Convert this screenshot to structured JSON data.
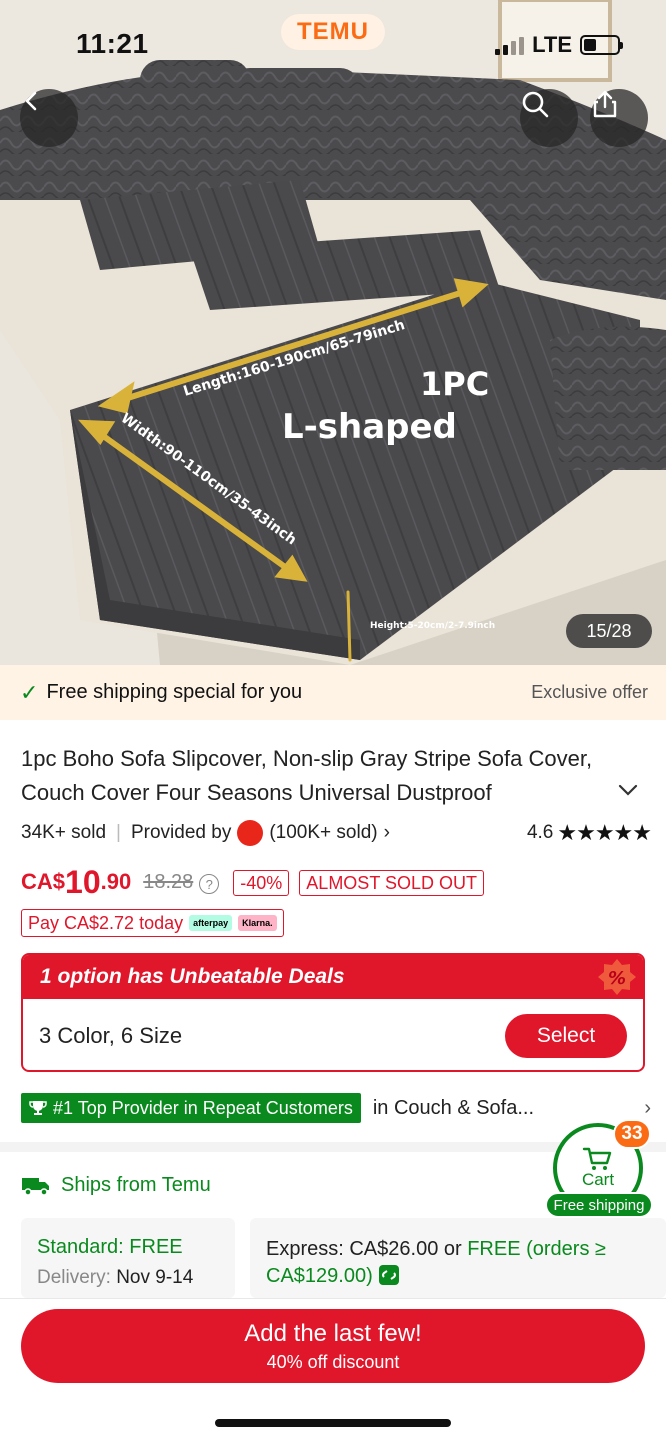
{
  "status_bar": {
    "time": "11:21",
    "network": "LTE"
  },
  "brand": "TEMU",
  "gallery": {
    "counter": "15/28",
    "overlay_title_1": "1PC",
    "overlay_title_2": "L-shaped",
    "length_label": "Length:160-190cm/65-79inch",
    "width_label": "Width:90-110cm/35-43inch",
    "height_label": "Height:5-20cm/2-7.9inch"
  },
  "shipping_banner": {
    "text": "Free shipping special for you",
    "tag": "Exclusive offer"
  },
  "product": {
    "title": "1pc Boho Sofa Slipcover, Non-slip Gray Stripe Sofa Cover, Couch Cover Four Seasons Universal Dustproof",
    "sold": "34K+ sold",
    "provided_by": "Provided by",
    "store_sold": "(100K+ sold)",
    "rating": "4.6",
    "stars": "★★★★★"
  },
  "price": {
    "currency": "CA$",
    "main": "10",
    "decimal": ".90",
    "original": "18.28",
    "discount_tag": "-40%",
    "stock_tag": "ALMOST SOLD OUT",
    "pay_today": "Pay CA$2.72 today",
    "afterpay": "afterpay",
    "klarna": "Klarna."
  },
  "deals": {
    "header": "1 option has Unbeatable Deals",
    "options": "3 Color, 6 Size",
    "select_label": "Select"
  },
  "provider_badge": {
    "text": "#1 Top Provider in Repeat Customers",
    "category": "in Couch & Sofa..."
  },
  "shipping": {
    "ships_from": "Ships from Temu",
    "standard_label": "Standard: FREE",
    "delivery_label": "Delivery:",
    "delivery_dates": "Nov 9-14",
    "express_prefix": "Express: CA$26.00 or ",
    "express_free": "FREE (orders ≥ CA$129.00)"
  },
  "cart": {
    "label": "Cart",
    "count": "33",
    "free_shipping": "Free shipping"
  },
  "cta": {
    "main": "Add the last few!",
    "sub": "40% off discount"
  },
  "colors": {
    "accent_red": "#e0162b",
    "green": "#0a8a1e",
    "orange": "#fb6b13"
  }
}
